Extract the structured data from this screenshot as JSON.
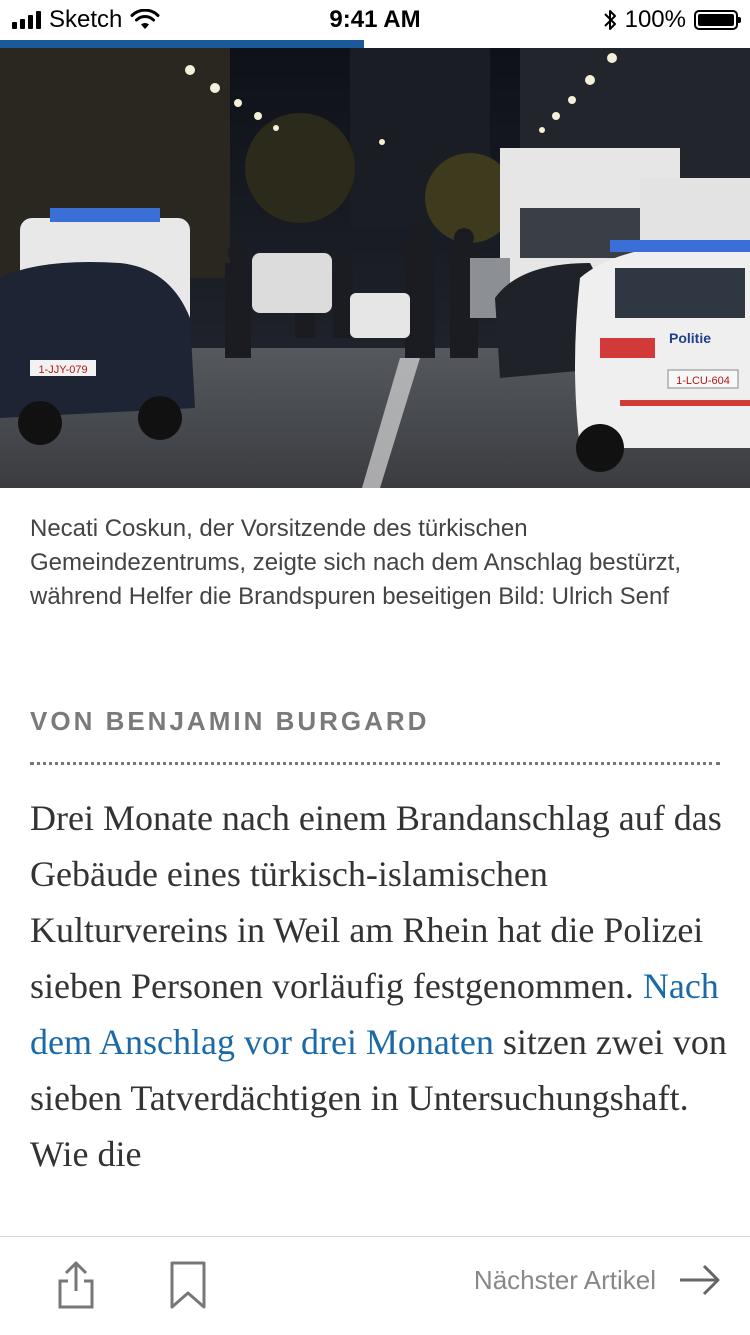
{
  "status_bar": {
    "carrier": "Sketch",
    "time": "9:41 AM",
    "battery": "100%",
    "battery_level": 1.0,
    "icons": [
      "signal-icon",
      "wifi-icon",
      "bluetooth-icon",
      "battery-icon"
    ]
  },
  "reading_progress": 0.485,
  "hero_image": {
    "plate_left": "1-JJY-079",
    "plate_right": "1-LCU-604",
    "car_label": "Politie"
  },
  "caption": "Necati Coskun, der Vorsitzende des türkischen Gemeindezentrums, zeigte sich nach dem Anschlag bestürzt, während Helfer die Brandspuren beseitigen Bild: Ulrich Senf",
  "byline": "VON BENJAMIN BURGARD",
  "body": {
    "text_before_link": "Drei Monate nach einem Brandanschlag auf das Gebäude eines türkisch-islamischen Kulturvereins in Weil am Rhein  hat die Polizei sieben Personen vorläufig festgenommen. ",
    "link_text": "Nach dem Anschlag vor drei Monaten",
    "text_after_link": " sitzen zwei von sieben Tatverdächtigen in Untersuchungshaft. Wie die"
  },
  "toolbar": {
    "next_label": "Nächster Artikel",
    "icons": [
      "share-icon",
      "bookmark-icon",
      "arrow-right-icon"
    ]
  },
  "colors": {
    "accent": "#1a5a9a",
    "link": "#1a6aa8",
    "text": "#333333",
    "muted": "#7a7a7a"
  }
}
